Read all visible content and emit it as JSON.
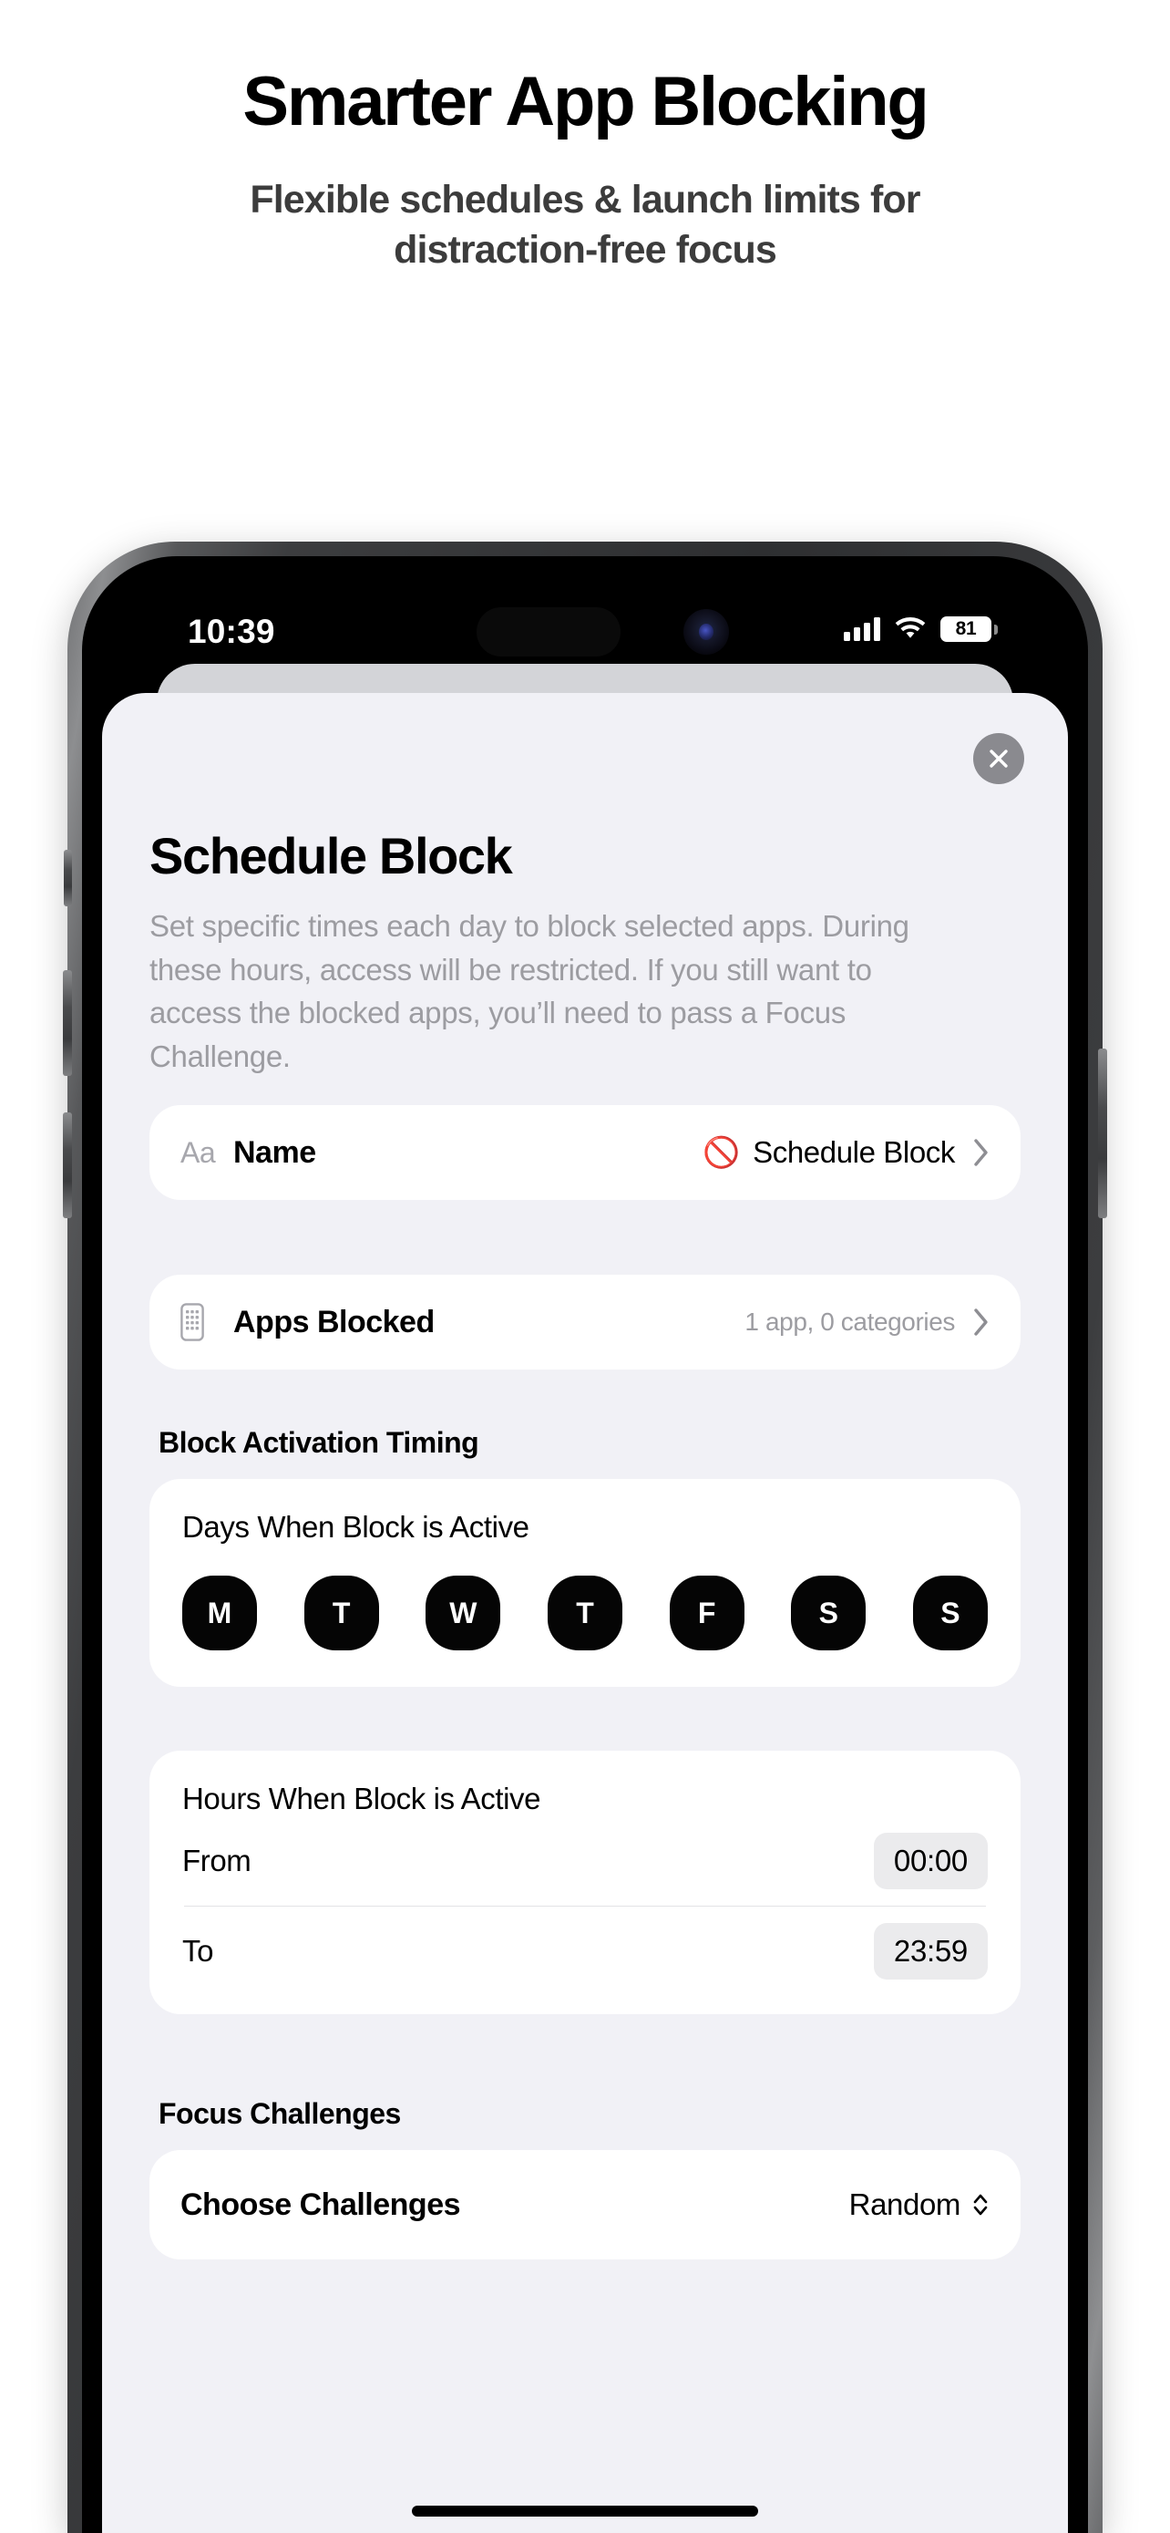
{
  "promo": {
    "title": "Smarter App Blocking",
    "subtitle": "Flexible schedules & launch limits for distraction-free focus"
  },
  "status_bar": {
    "time": "10:39",
    "battery_percent": "81",
    "cellular_icon": "cellular-bars-icon",
    "wifi_icon": "wifi-icon",
    "battery_icon": "battery-icon"
  },
  "sheet": {
    "close_label": "×",
    "title": "Schedule Block",
    "description": "Set specific times each day to block selected apps. During these hours, access will be restricted. If you still want to access the blocked apps, you’ll need to pass a Focus Challenge.",
    "rows": {
      "name": {
        "icon": "Aa",
        "label": "Name",
        "value_emoji": "🚫",
        "value": "Schedule Block"
      },
      "apps_blocked": {
        "label": "Apps Blocked",
        "value": "1 app, 0 categories"
      }
    },
    "sections": {
      "timing": {
        "header": "Block Activation Timing",
        "days_card": {
          "title": "Days When Block is Active",
          "days": [
            {
              "letter": "M",
              "selected": true
            },
            {
              "letter": "T",
              "selected": true
            },
            {
              "letter": "W",
              "selected": true
            },
            {
              "letter": "T",
              "selected": true
            },
            {
              "letter": "F",
              "selected": true
            },
            {
              "letter": "S",
              "selected": true
            },
            {
              "letter": "S",
              "selected": true
            }
          ]
        },
        "hours_card": {
          "title": "Hours When Block is Active",
          "from_label": "From",
          "from_value": "00:00",
          "to_label": "To",
          "to_value": "23:59"
        }
      },
      "focus": {
        "header": "Focus Challenges",
        "choose_card": {
          "label": "Choose Challenges",
          "value": "Random"
        }
      }
    }
  },
  "colors": {
    "sheet_bg": "#f1f1f6",
    "card_bg": "#ffffff",
    "accent_black": "#050505",
    "muted_text": "#9c9ca1",
    "chip_bg": "#ebebed"
  }
}
